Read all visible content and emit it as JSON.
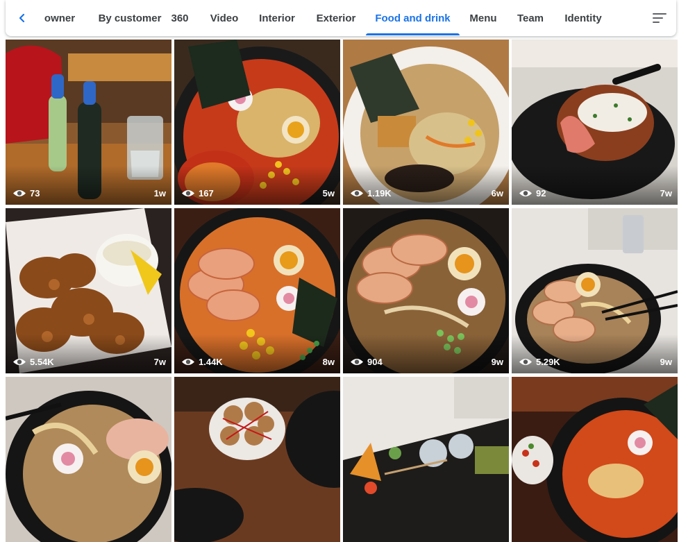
{
  "tabs": [
    {
      "label": "owner",
      "active": false
    },
    {
      "label": "By customer",
      "active": false
    },
    {
      "label": "360",
      "active": false
    },
    {
      "label": "Video",
      "active": false
    },
    {
      "label": "Interior",
      "active": false
    },
    {
      "label": "Exterior",
      "active": false
    },
    {
      "label": "Food and drink",
      "active": true
    },
    {
      "label": "Menu",
      "active": false
    },
    {
      "label": "Team",
      "active": false
    },
    {
      "label": "Identity",
      "active": false
    }
  ],
  "icons": {
    "back": "chevron-left-icon",
    "filter": "filter-menu-icon",
    "views": "eye-icon"
  },
  "colors": {
    "accent": "#1a73e8",
    "tab_text": "#3c4043"
  },
  "photos": [
    {
      "views": "73",
      "age": "1w",
      "subject": "ramune-bottles-and-water"
    },
    {
      "views": "167",
      "age": "5w",
      "subject": "spicy-ramen-bowl"
    },
    {
      "views": "1.19K",
      "age": "6w",
      "subject": "ramen-white-bowl"
    },
    {
      "views": "92",
      "age": "7w",
      "subject": "cutlet-with-sauce"
    },
    {
      "views": "5.54K",
      "age": "7w",
      "subject": "karaage-chicken"
    },
    {
      "views": "1.44K",
      "age": "8w",
      "subject": "chashu-ramen"
    },
    {
      "views": "904",
      "age": "9w",
      "subject": "tonkotsu-ramen"
    },
    {
      "views": "5.29K",
      "age": "9w",
      "subject": "ramen-with-chopsticks"
    },
    {
      "views": "",
      "age": "",
      "subject": "ramen-with-narutomaki"
    },
    {
      "views": "",
      "age": "",
      "subject": "marinated-eggs"
    },
    {
      "views": "",
      "age": "",
      "subject": "dango-dessert-plate"
    },
    {
      "views": "",
      "age": "",
      "subject": "spicy-ramen-closeup"
    }
  ]
}
